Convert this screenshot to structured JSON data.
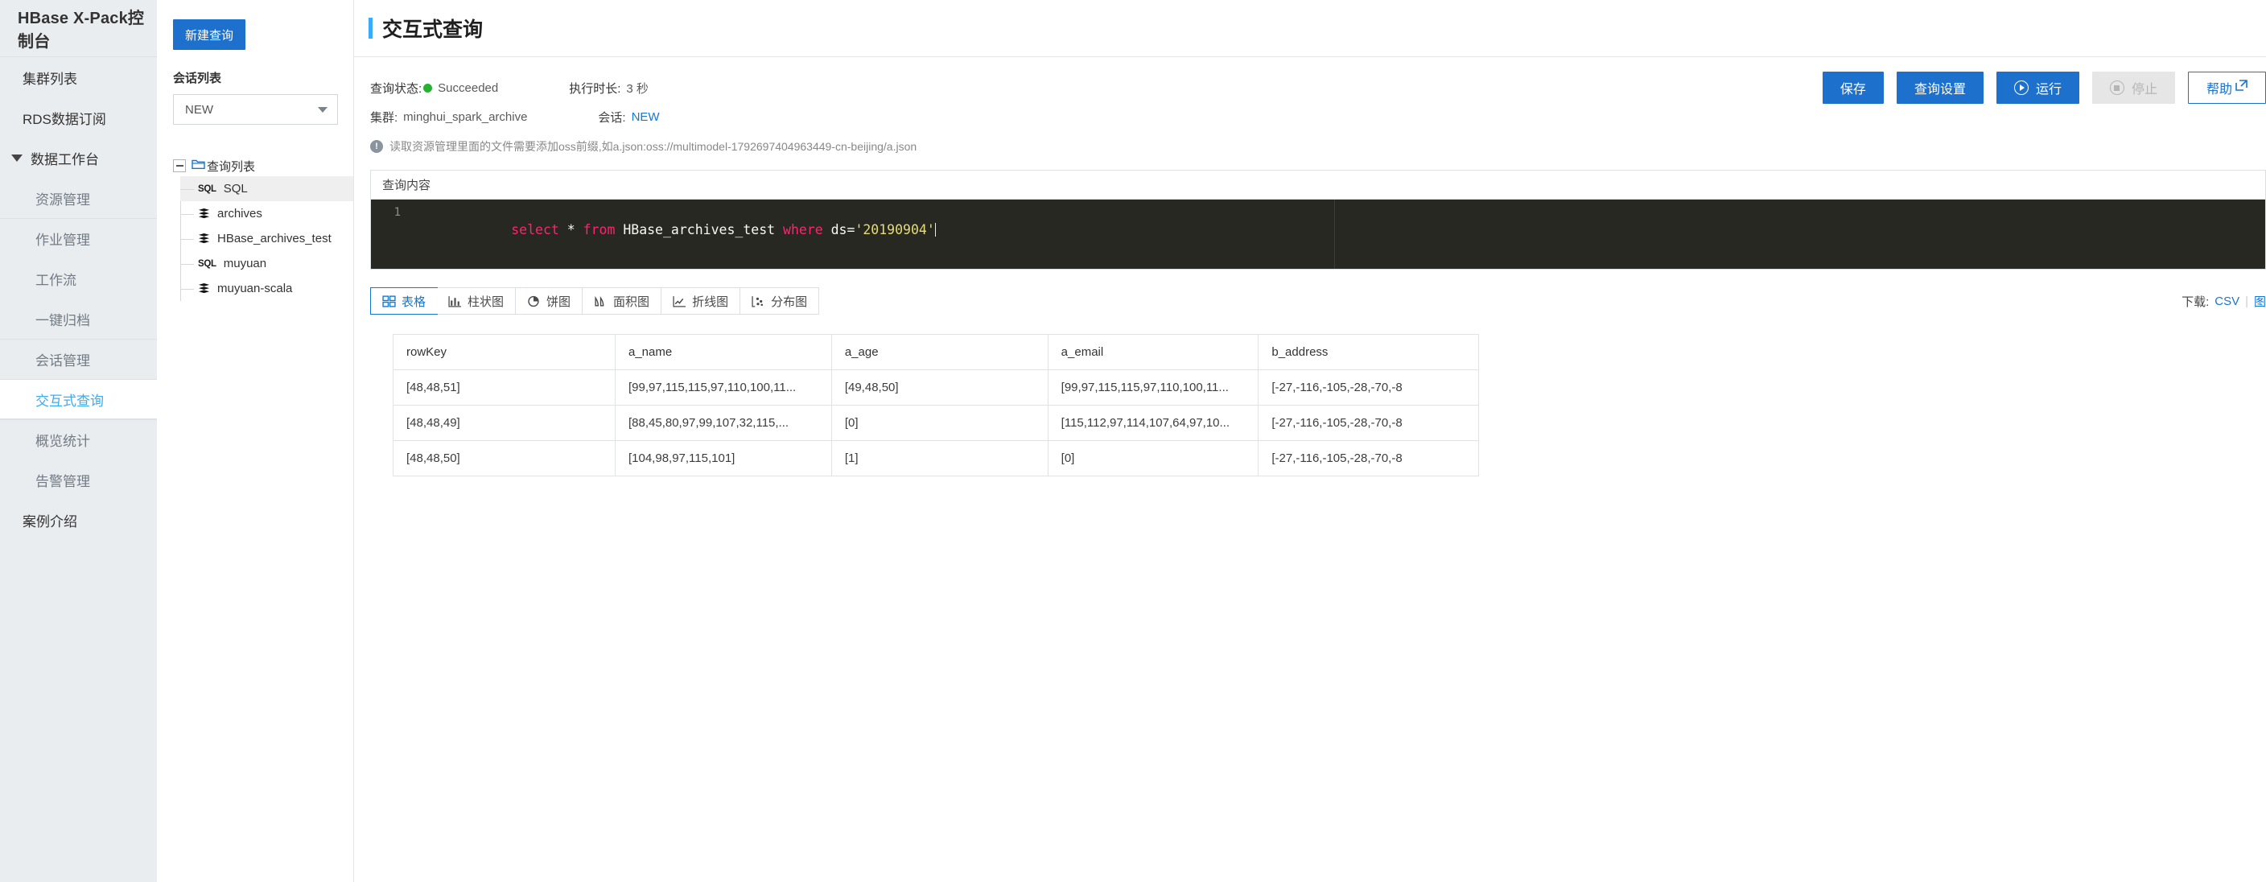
{
  "sidebar": {
    "brand": "HBase X-Pack控制台",
    "items": [
      {
        "label": "集群列表",
        "level": "top",
        "active": false
      },
      {
        "label": "RDS数据订阅",
        "level": "top",
        "active": false
      },
      {
        "label": "数据工作台",
        "level": "group",
        "active": false,
        "caret": true
      },
      {
        "label": "资源管理",
        "level": "child",
        "active": false
      },
      {
        "label": "作业管理",
        "level": "child",
        "active": false
      },
      {
        "label": "工作流",
        "level": "child",
        "active": false
      },
      {
        "label": "一键归档",
        "level": "child",
        "active": false
      },
      {
        "label": "会话管理",
        "level": "child",
        "active": false
      },
      {
        "label": "交互式查询",
        "level": "child",
        "active": true
      },
      {
        "label": "概览统计",
        "level": "child",
        "active": false
      },
      {
        "label": "告警管理",
        "level": "child",
        "active": false
      },
      {
        "label": "案例介绍",
        "level": "top",
        "active": false
      }
    ]
  },
  "header": {
    "title": "交互式查询"
  },
  "tree_panel": {
    "new_query_label": "新建查询",
    "session_list_label": "会话列表",
    "session_selected": "NEW",
    "tree_root": "查询列表",
    "nodes": [
      {
        "label": "SQL",
        "icon": "sql-icon",
        "selected": true
      },
      {
        "label": "archives",
        "icon": "stack-icon",
        "selected": false
      },
      {
        "label": "HBase_archives_test",
        "icon": "stack-icon",
        "selected": false
      },
      {
        "label": "muyuan",
        "icon": "sql-icon",
        "selected": false
      },
      {
        "label": "muyuan-scala",
        "icon": "stack-icon",
        "selected": false
      }
    ]
  },
  "status": {
    "query_status_label": "查询状态:",
    "query_status_value": "Succeeded",
    "status_color": "#25b231",
    "duration_label": "执行时长:",
    "duration_value": "3 秒",
    "cluster_label": "集群:",
    "cluster_value": "minghui_spark_archive",
    "session_label": "会话:",
    "session_value": "NEW",
    "hint": "读取资源管理里面的文件需要添加oss前缀,如a.json:oss://multimodel-1792697404963449-cn-beijing/a.json"
  },
  "actions": {
    "save": "保存",
    "settings": "查询设置",
    "run": "运行",
    "stop": "停止",
    "help": "帮助"
  },
  "editor": {
    "title": "查询内容",
    "line_number": "1",
    "sql_tokens": [
      {
        "t": "select",
        "k": "kw"
      },
      {
        "t": " * ",
        "k": ""
      },
      {
        "t": "from",
        "k": "kw"
      },
      {
        "t": " HBase_archives_test ",
        "k": ""
      },
      {
        "t": "where",
        "k": "kw"
      },
      {
        "t": " ds=",
        "k": ""
      },
      {
        "t": "'20190904'",
        "k": "str"
      }
    ],
    "sql_text": "select * from HBase_archives_test where ds='20190904'"
  },
  "result_tabs": [
    {
      "label": "表格",
      "icon": "grid-icon",
      "active": true
    },
    {
      "label": "柱状图",
      "icon": "bar-chart-icon",
      "active": false
    },
    {
      "label": "饼图",
      "icon": "pie-chart-icon",
      "active": false
    },
    {
      "label": "面积图",
      "icon": "area-chart-icon",
      "active": false
    },
    {
      "label": "折线图",
      "icon": "line-chart-icon",
      "active": false
    },
    {
      "label": "分布图",
      "icon": "scatter-chart-icon",
      "active": false
    }
  ],
  "download": {
    "label": "下载:",
    "csv": "CSV",
    "pipe": "|",
    "image": "图"
  },
  "result_table": {
    "columns": [
      "rowKey",
      "a_name",
      "a_age",
      "a_email",
      "b_address"
    ],
    "rows": [
      [
        "[48,48,51]",
        "[99,97,115,115,97,110,100,11...",
        "[49,48,50]",
        "[99,97,115,115,97,110,100,11...",
        "[-27,-116,-105,-28,-70,-8"
      ],
      [
        "[48,48,49]",
        "[88,45,80,97,99,107,32,115,...",
        "[0]",
        "[115,112,97,114,107,64,97,10...",
        "[-27,-116,-105,-28,-70,-8"
      ],
      [
        "[48,48,50]",
        "[104,98,97,115,101]",
        "[1]",
        "[0]",
        "[-27,-116,-105,-28,-70,-8"
      ]
    ]
  }
}
